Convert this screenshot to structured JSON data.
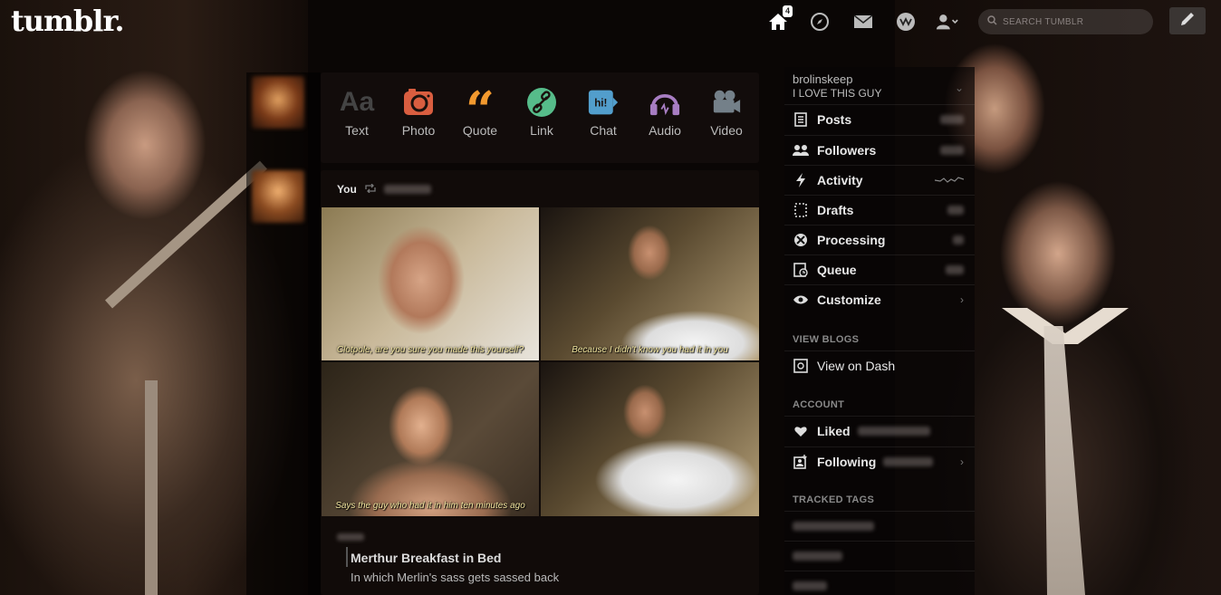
{
  "header": {
    "logo": "tumblr.",
    "home_badge": "4",
    "search_placeholder": "SEARCH TUMBLR",
    "icons": [
      "home-icon",
      "explore-compass-icon",
      "inbox-mail-icon",
      "activity-icon",
      "account-icon",
      "compose-pencil-icon"
    ]
  },
  "post_types": [
    {
      "label": "Text",
      "icon": "text-icon",
      "color": "#444444"
    },
    {
      "label": "Photo",
      "icon": "camera-icon",
      "color": "#d95e40"
    },
    {
      "label": "Quote",
      "icon": "quote-icon",
      "color": "#f2992e"
    },
    {
      "label": "Link",
      "icon": "link-icon",
      "color": "#56bc8a"
    },
    {
      "label": "Chat",
      "icon": "chat-icon",
      "color": "#529ecc"
    },
    {
      "label": "Audio",
      "icon": "headphones-icon",
      "color": "#a77dc2"
    },
    {
      "label": "Video",
      "icon": "video-camera-icon",
      "color": "#748089"
    }
  ],
  "post": {
    "author": "You",
    "captions": [
      "Clotpole, are you sure you made this yourself?",
      "Because I didn't know you had it in you",
      "Says the guy who had it in him ten minutes ago",
      ""
    ],
    "title": "Merthur Breakfast in Bed",
    "body": "In which Merlin's sass gets sassed back"
  },
  "sidebar": {
    "blog_name": "brolinskeep",
    "blog_title": "I LOVE THIS GUY",
    "menu": [
      {
        "label": "Posts",
        "icon": "posts-icon"
      },
      {
        "label": "Followers",
        "icon": "followers-icon"
      },
      {
        "label": "Activity",
        "icon": "lightning-icon"
      },
      {
        "label": "Drafts",
        "icon": "drafts-icon"
      },
      {
        "label": "Processing",
        "icon": "processing-icon"
      },
      {
        "label": "Queue",
        "icon": "queue-icon"
      },
      {
        "label": "Customize",
        "icon": "eye-icon"
      }
    ],
    "view_blogs_label": "VIEW BLOGS",
    "view_on_dash": "View on Dash",
    "account_label": "ACCOUNT",
    "liked": "Liked",
    "following": "Following",
    "tracked_tags_label": "TRACKED TAGS"
  }
}
